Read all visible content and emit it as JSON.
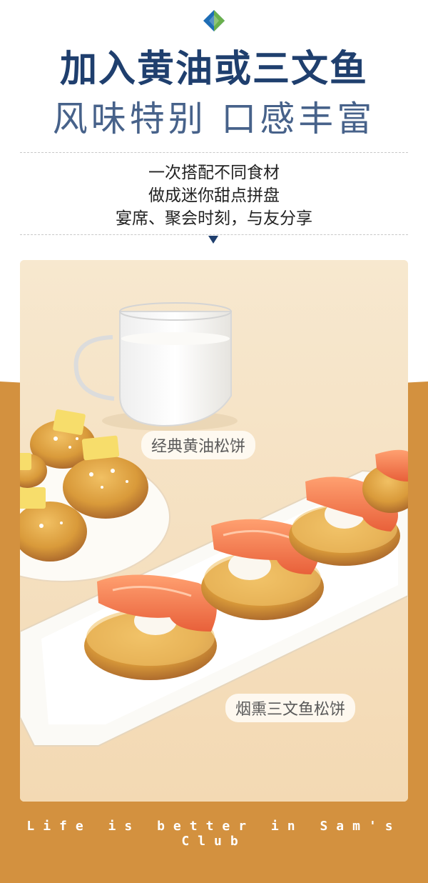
{
  "header": {
    "title_line1": "加入黄油或三文鱼",
    "title_line2": "风味特别 口感丰富"
  },
  "description": {
    "line1": "一次搭配不同食材",
    "line2": "做成迷你甜点拼盘",
    "line3": "宴席、聚会时刻，与友分享"
  },
  "photo": {
    "label_butter": "经典黄油松饼",
    "label_salmon": "烟熏三文鱼松饼"
  },
  "footer": {
    "slogan": "Life is better in Sam's Club"
  },
  "colors": {
    "title_navy": "#1f3f6e",
    "subtitle_blue": "#47628a",
    "band_orange": "#d3913f",
    "logo_blue": "#1e6db5",
    "logo_green": "#6ab04c"
  },
  "icons": {
    "brand_logo": "sams-club-diamond-icon",
    "divider_arrow": "triangle-down-icon"
  }
}
